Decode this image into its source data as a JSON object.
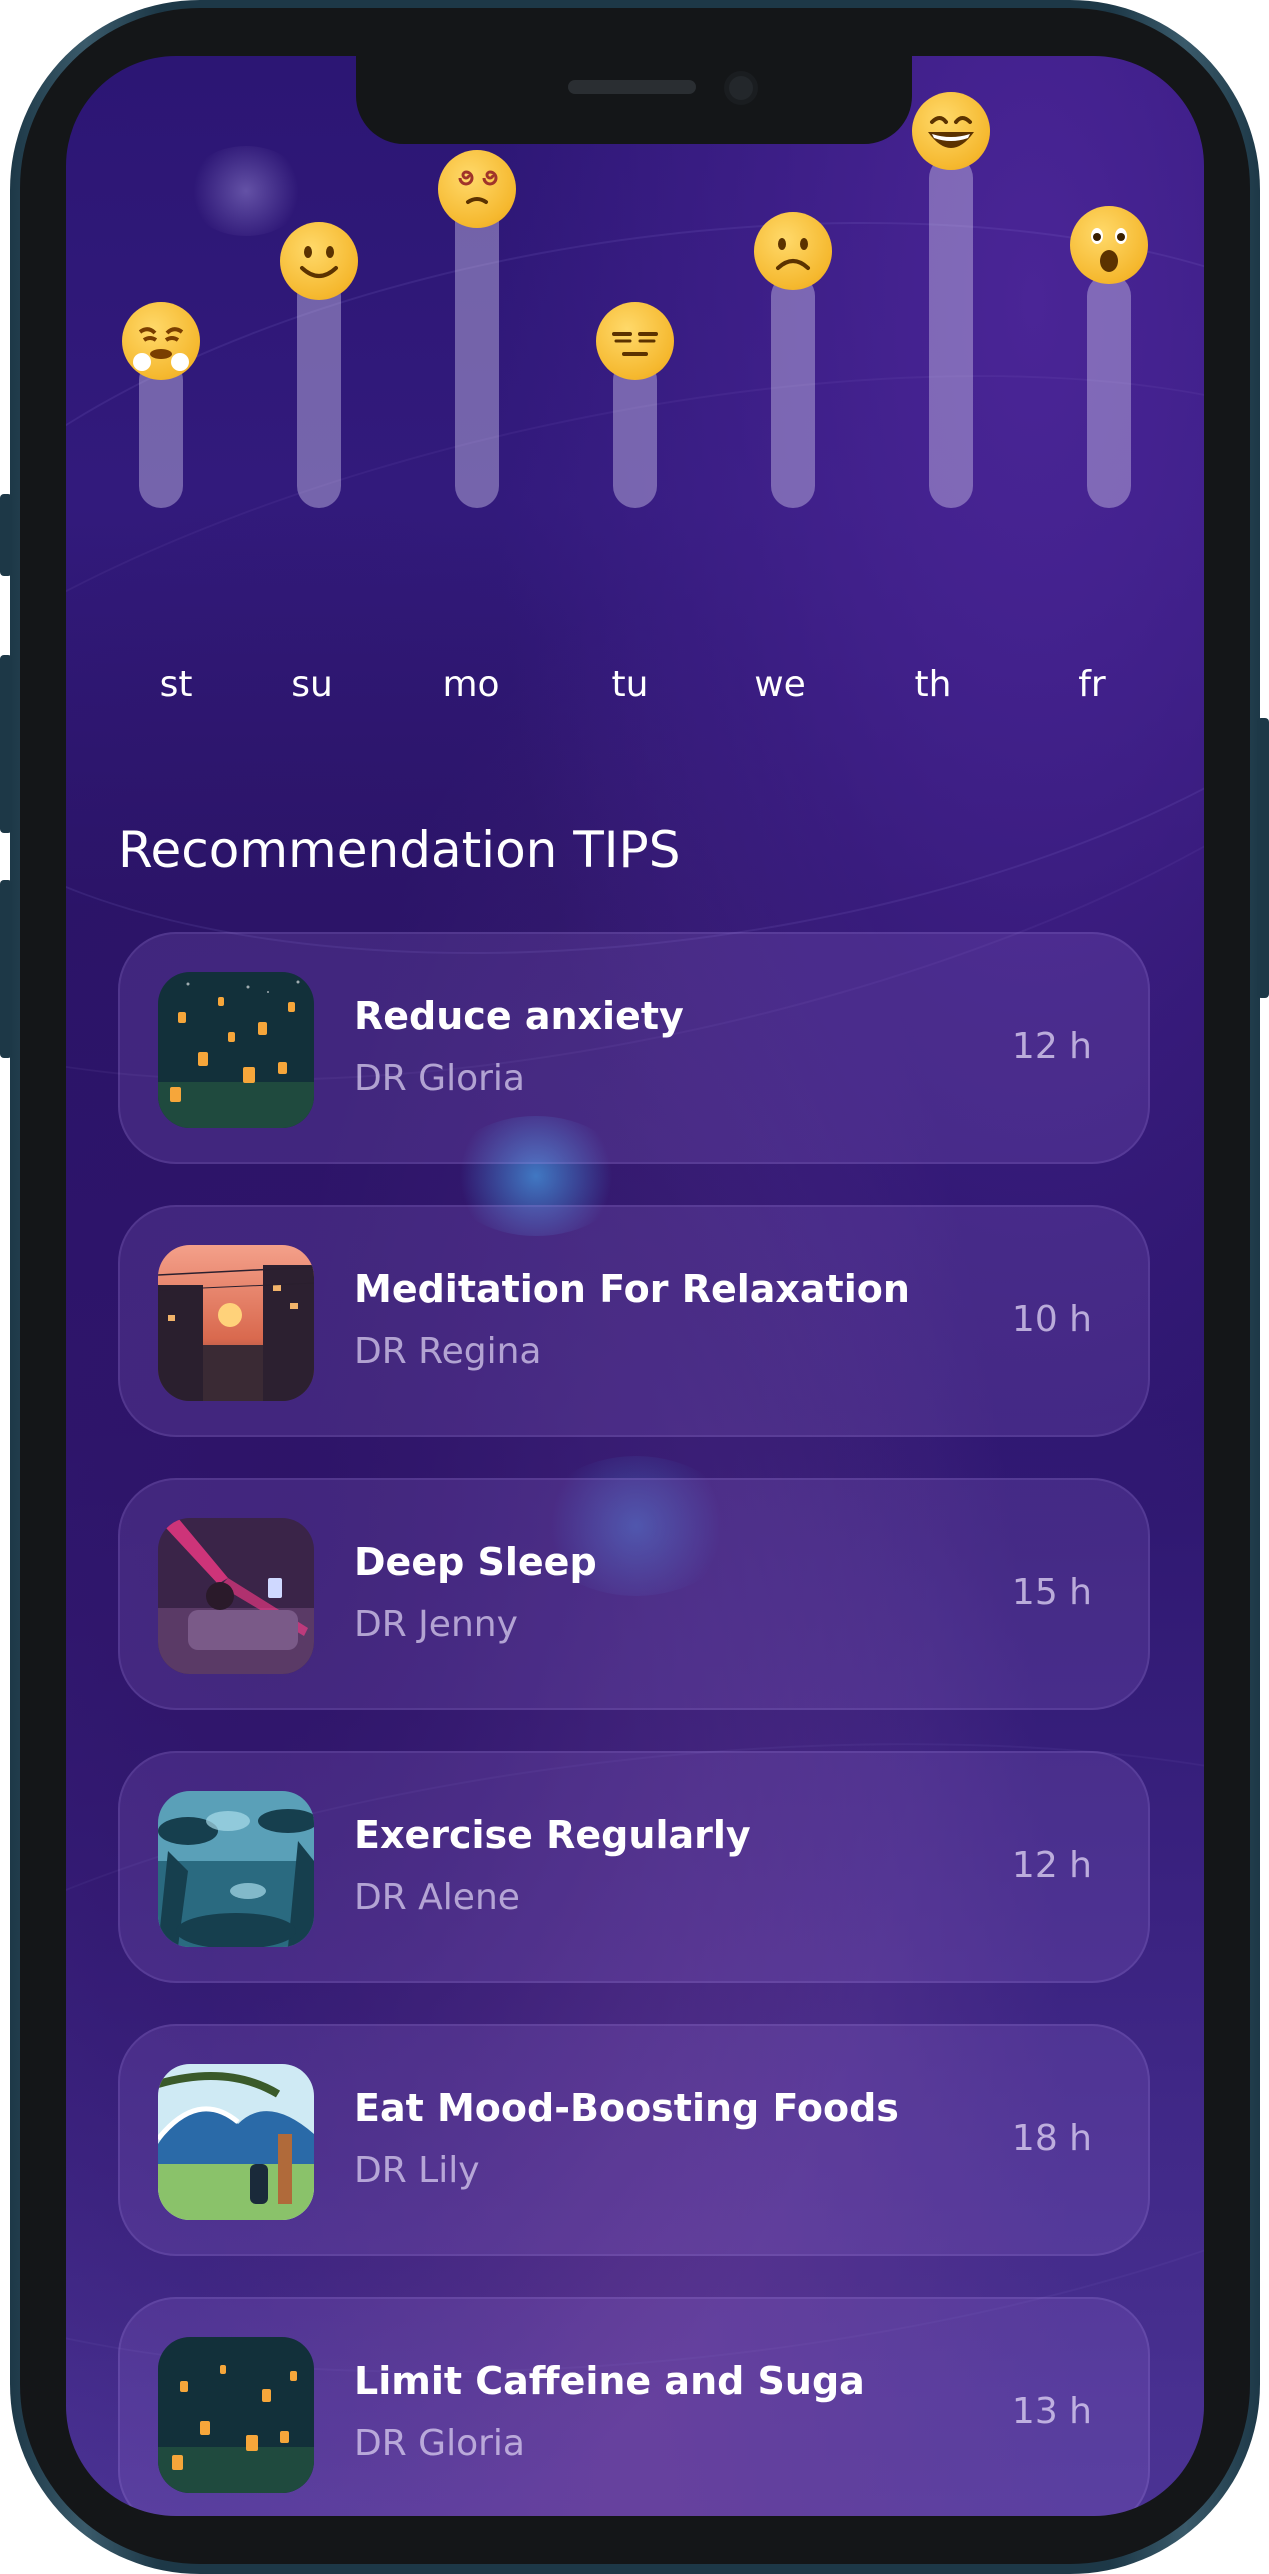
{
  "mood_chart": {
    "days": [
      {
        "label": "st",
        "mood": "angry-face"
      },
      {
        "label": "su",
        "mood": "smiling-face"
      },
      {
        "label": "mo",
        "mood": "dizzy-face"
      },
      {
        "label": "tu",
        "mood": "expressionless-face"
      },
      {
        "label": "we",
        "mood": "frowning-face"
      },
      {
        "label": "th",
        "mood": "grinning-face"
      },
      {
        "label": "fr",
        "mood": "surprised-face"
      }
    ]
  },
  "section_title": "Recommendation TIPS",
  "tips": [
    {
      "title": "Reduce anxiety",
      "author": "DR Gloria",
      "duration": "12 h",
      "image": "lanterns-night-image"
    },
    {
      "title": "Meditation For Relaxation",
      "author": "DR Regina",
      "duration": "10 h",
      "image": "sunset-street-image"
    },
    {
      "title": "Deep Sleep",
      "author": "DR Jenny",
      "duration": "15 h",
      "image": "bedroom-neon-image"
    },
    {
      "title": "Exercise Regularly",
      "author": "DR Alene",
      "duration": "12 h",
      "image": "jungle-image"
    },
    {
      "title": "Eat Mood-Boosting Foods",
      "author": "DR Lily",
      "duration": "18 h",
      "image": "ocean-wave-image"
    },
    {
      "title": "Limit Caffeine and Suga",
      "author": "DR Gloria",
      "duration": "13 h",
      "image": "lanterns-night-image"
    }
  ],
  "colors": {
    "background_top": "#2c1674",
    "background_bottom": "#4b3394",
    "card": "#5a3a9a",
    "emoji": "#f5b82e",
    "frame": "#1d3847"
  }
}
